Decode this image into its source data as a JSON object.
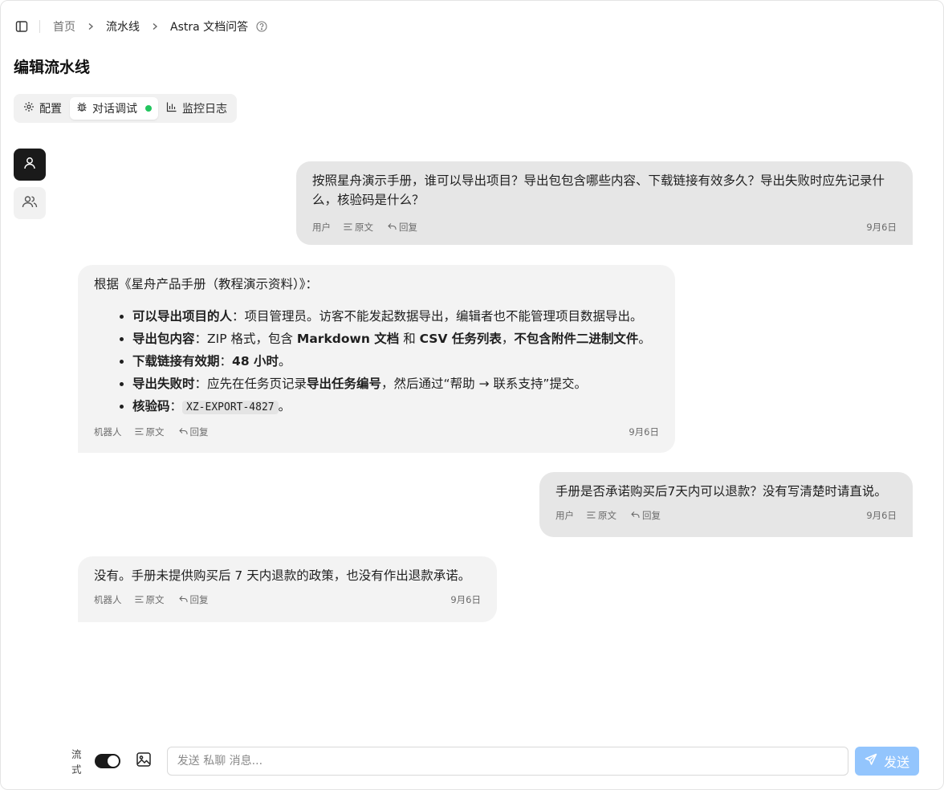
{
  "header": {
    "breadcrumb": [
      "首页",
      "流水线",
      "Astra 文档问答"
    ]
  },
  "page_title": "编辑流水线",
  "tabs": [
    {
      "label": "配置",
      "icon": "gear-icon"
    },
    {
      "label": "对话调试",
      "icon": "bug-icon",
      "active": true,
      "status_color": "#22c55e"
    },
    {
      "label": "监控日志",
      "icon": "bar-chart-icon"
    }
  ],
  "messages": [
    {
      "role": "user",
      "text": "按照星舟演示手册，谁可以导出项目？导出包包含哪些内容、下载链接有效多久？导出失败时应先记录什么，核验码是什么？",
      "role_label": "用户",
      "source_label": "原文",
      "reply_label": "回复",
      "date": "9月6日"
    },
    {
      "role": "bot",
      "intro": "根据《星舟产品手册（教程演示资料）》：",
      "items": [
        {
          "k": "可以导出项目的人",
          "v": "：项目管理员。访客不能发起数据导出，编辑者也不能管理项目数据导出。"
        },
        {
          "k": "导出包内容",
          "v1": "：ZIP 格式，包含 ",
          "b1": "Markdown 文档",
          "v2": " 和 ",
          "b2": "CSV 任务列表",
          "v3": "，",
          "b3": "不包含附件二进制文件",
          "v4": "。"
        },
        {
          "k": "下载链接有效期",
          "v1": "：",
          "b1": "48 小时",
          "v2": "。"
        },
        {
          "k": "导出失败时",
          "v1": "：应先在任务页记录",
          "b1": "导出任务编号",
          "v2": "，然后通过“帮助 → 联系支持”提交。"
        },
        {
          "k": "核验码",
          "v1": "：",
          "code": "XZ-EXPORT-4827",
          "v2": "。"
        }
      ],
      "role_label": "机器人",
      "source_label": "原文",
      "reply_label": "回复",
      "date": "9月6日"
    },
    {
      "role": "user",
      "text": "手册是否承诺购买后7天内可以退款？没有写清楚时请直说。",
      "role_label": "用户",
      "source_label": "原文",
      "reply_label": "回复",
      "date": "9月6日"
    },
    {
      "role": "bot",
      "text": "没有。手册未提供购买后 7 天内退款的政策，也没有作出退款承诺。",
      "role_label": "机器人",
      "source_label": "原文",
      "reply_label": "回复",
      "date": "9月6日"
    }
  ],
  "input": {
    "stream_label": "流式",
    "stream_on": true,
    "placeholder": "发送 私聊 消息...",
    "send_label": "发送",
    "send_color": "#93c5fd"
  }
}
